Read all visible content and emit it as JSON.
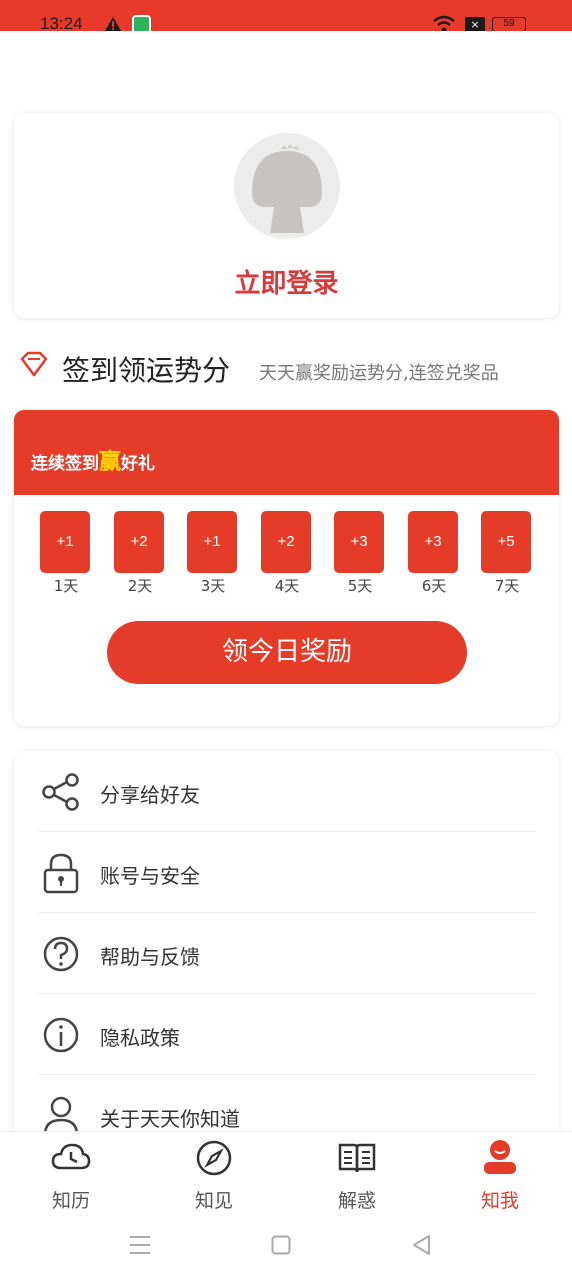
{
  "status_bar": {
    "time": "13:24",
    "battery": "59"
  },
  "login": {
    "label": "立即登录"
  },
  "signin": {
    "title": "签到领运势分",
    "subtitle": "天天赢奖励运势分,连签兑奖品"
  },
  "checkin": {
    "banner_pre": "连续签到",
    "banner_win": "赢",
    "banner_post": "好礼",
    "days": [
      {
        "reward": "+1",
        "label": "1天"
      },
      {
        "reward": "+2",
        "label": "2天"
      },
      {
        "reward": "+1",
        "label": "3天"
      },
      {
        "reward": "+2",
        "label": "4天"
      },
      {
        "reward": "+3",
        "label": "5天"
      },
      {
        "reward": "+3",
        "label": "6天"
      },
      {
        "reward": "+5",
        "label": "7天"
      }
    ],
    "claim_label": "领今日奖励"
  },
  "menu": {
    "items": [
      {
        "label": "分享给好友",
        "icon": "share-icon"
      },
      {
        "label": "账号与安全",
        "icon": "lock-icon"
      },
      {
        "label": "帮助与反馈",
        "icon": "help-icon"
      },
      {
        "label": "隐私政策",
        "icon": "info-icon"
      },
      {
        "label": "关于天天你知道",
        "icon": "user-icon"
      }
    ]
  },
  "tabs": [
    {
      "label": "知历",
      "icon": "clock-icon"
    },
    {
      "label": "知见",
      "icon": "compass-icon"
    },
    {
      "label": "解惑",
      "icon": "book-icon"
    },
    {
      "label": "知我",
      "icon": "profile-icon",
      "active": true
    }
  ],
  "colors": {
    "accent": "#e53c29",
    "login_text": "#d63a3a",
    "highlight": "#ffd400"
  }
}
